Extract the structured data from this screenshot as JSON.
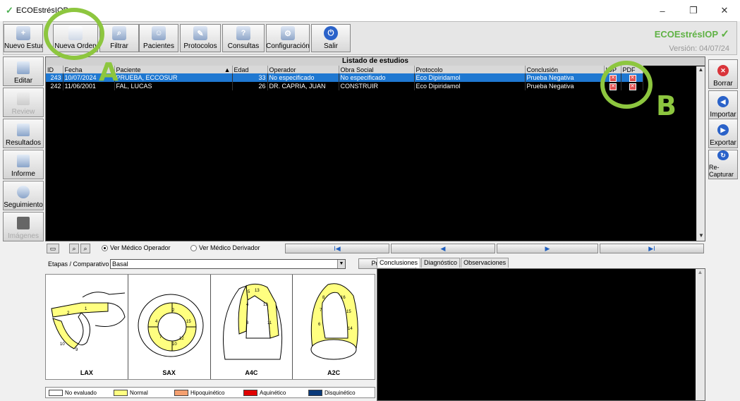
{
  "window": {
    "title": "ECOEstrésIOP",
    "min": "–",
    "restore": "❐",
    "close": "✕"
  },
  "toolbar": {
    "buttons": [
      "Nuevo Estudio",
      "Nueva Orden",
      "Filtrar",
      "Pacientes",
      "Protocolos",
      "Consultas",
      "Configuración",
      "Salir"
    ]
  },
  "brand": {
    "name": "ECOEstrésIOP",
    "version": "Versión: 04/07/24"
  },
  "left": {
    "buttons": [
      "Editar",
      "Review",
      "Resultados",
      "Informe",
      "Seguimiento",
      "Imágenes"
    ]
  },
  "right": {
    "buttons": [
      "Borrar",
      "Importar",
      "Exportar",
      "Re-Capturar"
    ]
  },
  "grid": {
    "title": "Listado de estudios",
    "columns": [
      "ID",
      "Fecha",
      "Paciente",
      "Edad",
      "Operador",
      "Obra Social",
      "Protocolo",
      "Conclusión",
      "IOP",
      "PDF"
    ],
    "sort_marker": "▲",
    "rows": [
      {
        "id": "243",
        "fecha": "10/07/2024",
        "paciente": "PRUEBA, ECCOSUR",
        "edad": "33",
        "operador": "No especificado",
        "obra": "No especificado",
        "protocolo": "Eco Dipiridamol",
        "conclusion": "Prueba Negativa"
      },
      {
        "id": "242",
        "fecha": "11/06/2001",
        "paciente": "FAL, LUCAS",
        "edad": "26",
        "operador": "DR. CAPRIA, JUAN",
        "obra": "CONSTRUIR",
        "protocolo": "Eco Dipiridamol",
        "conclusion": "Prueba Negativa"
      }
    ]
  },
  "nav": {
    "radio1": "Ver Médico Operador",
    "radio2": "Ver Médico Derivador",
    "first": "I◀",
    "prev": "◀",
    "next": "▶",
    "last": "▶I"
  },
  "etapas": {
    "label": "Etapas / Comparativo",
    "value": "Basal",
    "button": "Puntuación"
  },
  "views": [
    "LAX",
    "SAX",
    "A4C",
    "A2C"
  ],
  "legend": [
    {
      "label": "No evaluado",
      "color": "#ffffff"
    },
    {
      "label": "Normal",
      "color": "#ffff80"
    },
    {
      "label": "Hipoquinético",
      "color": "#f4a070"
    },
    {
      "label": "Aquinético",
      "color": "#e00000"
    },
    {
      "label": "Disquinético",
      "color": "#0a3a7a"
    }
  ],
  "tabs": [
    "Conclusiones",
    "Diagnóstico",
    "Observaciones"
  ],
  "annotations": {
    "a": "A",
    "b": "B"
  }
}
